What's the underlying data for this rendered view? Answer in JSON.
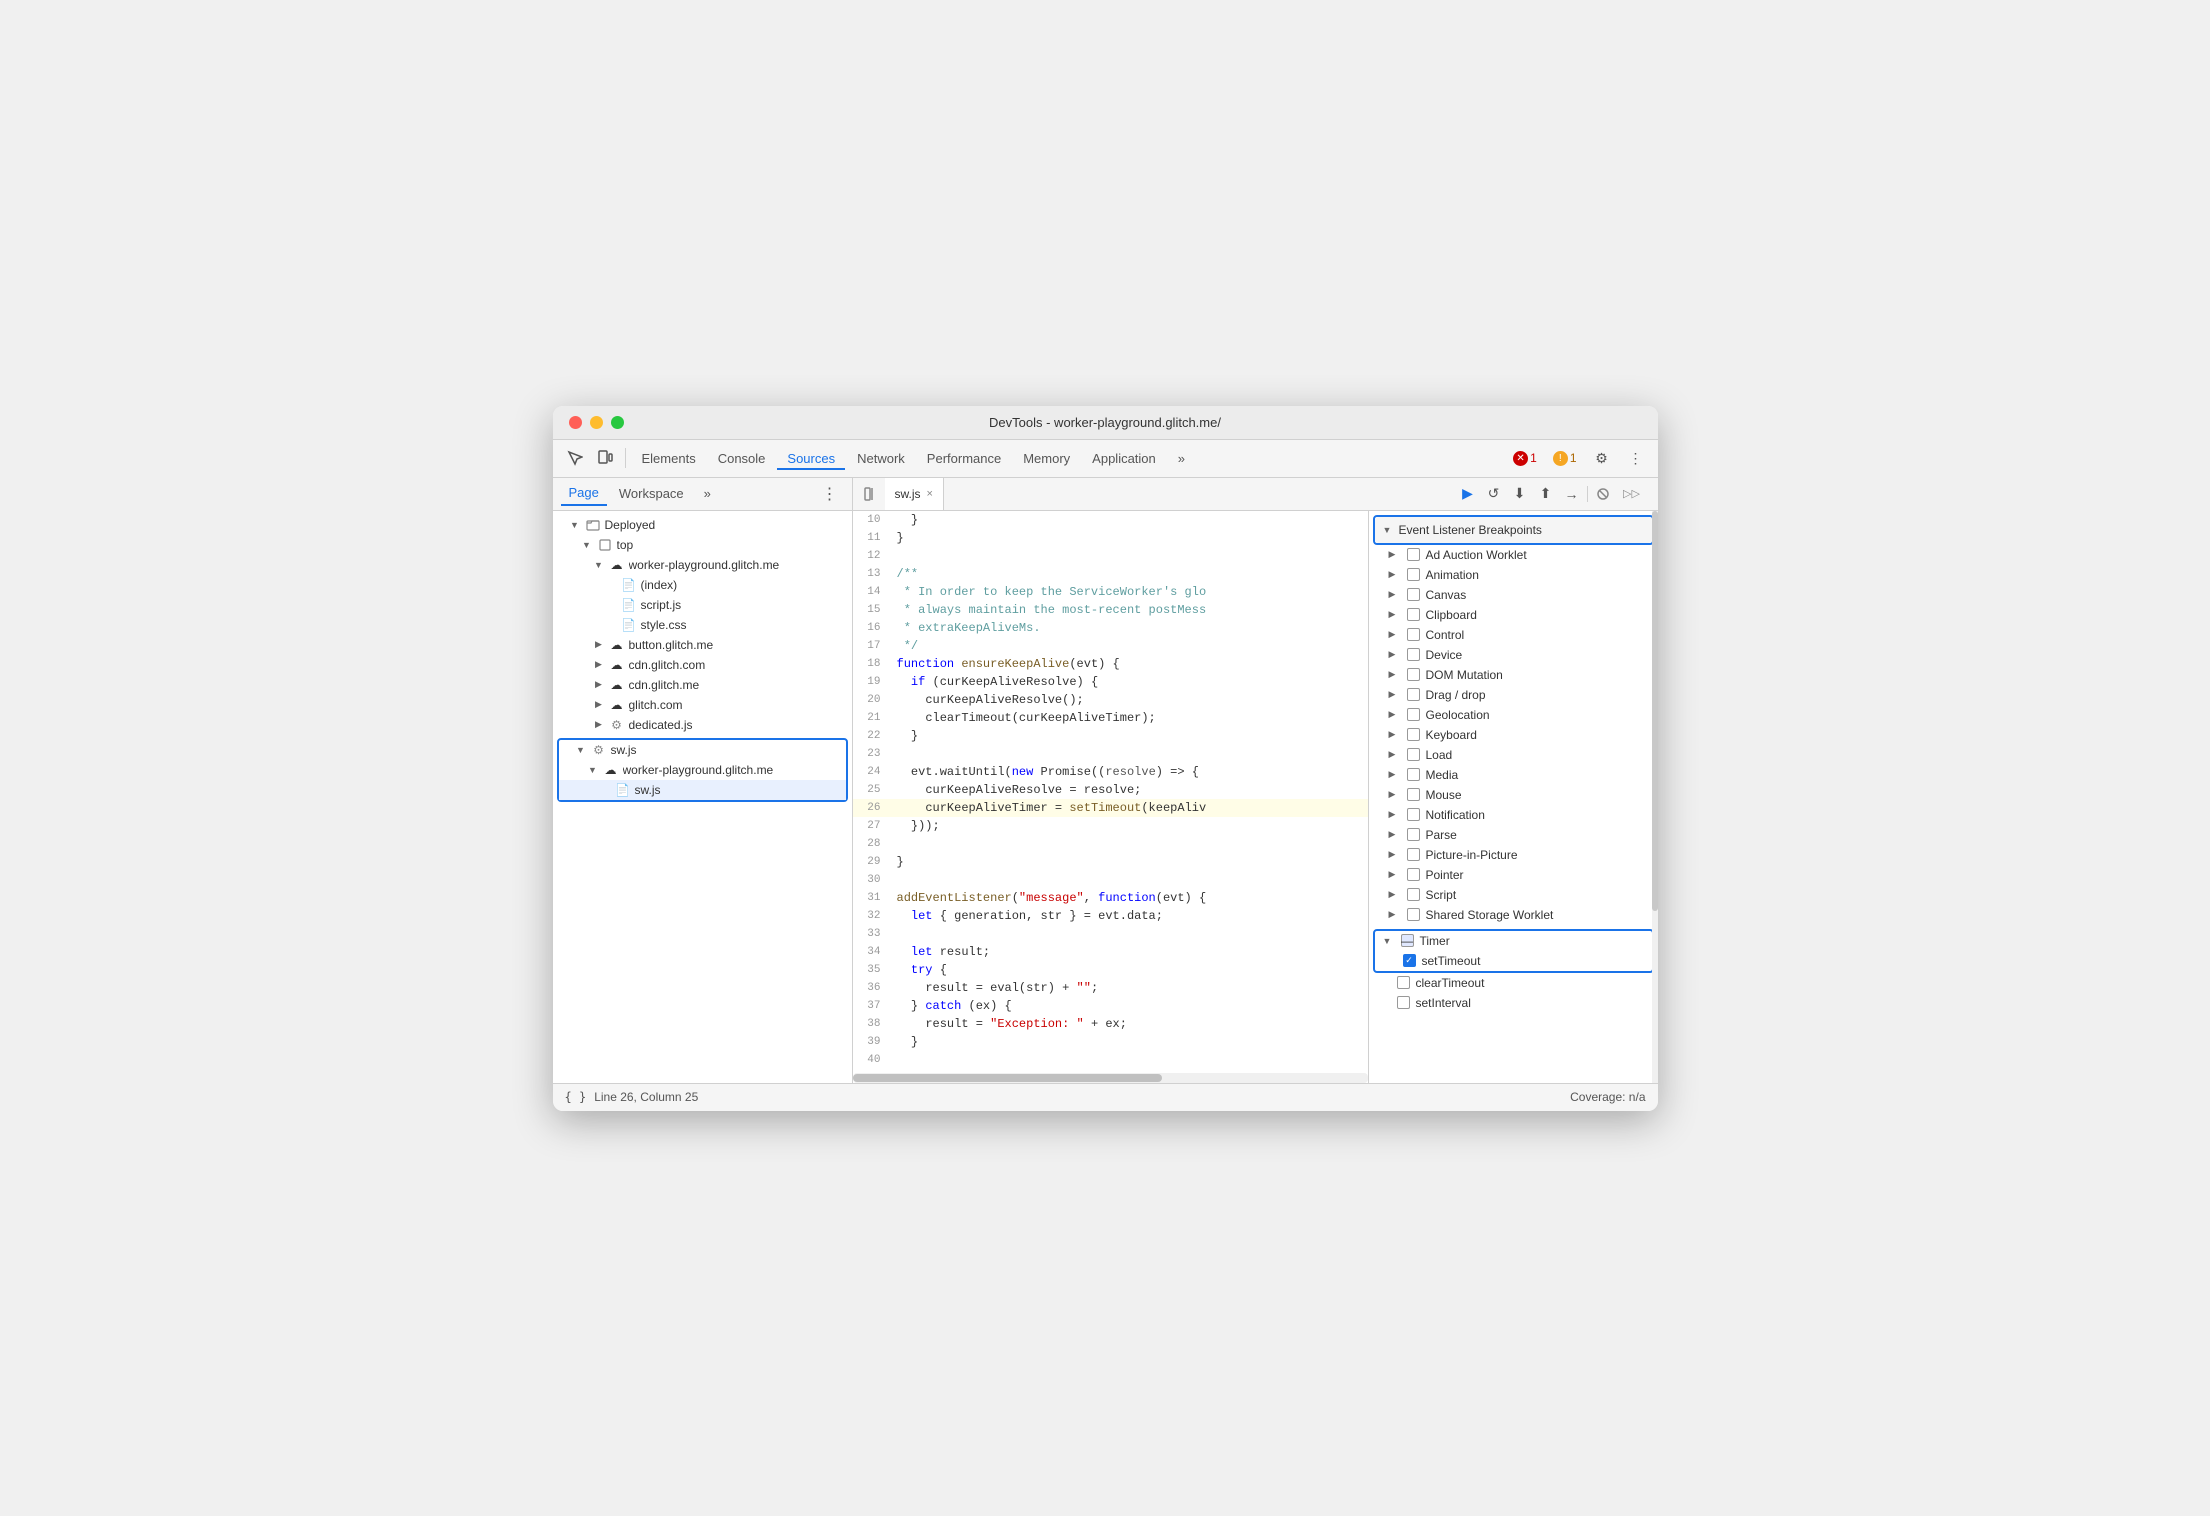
{
  "window": {
    "title": "DevTools - worker-playground.glitch.me/"
  },
  "toolbar": {
    "tabs": [
      {
        "label": "Elements",
        "active": false
      },
      {
        "label": "Console",
        "active": false
      },
      {
        "label": "Sources",
        "active": true
      },
      {
        "label": "Network",
        "active": false
      },
      {
        "label": "Performance",
        "active": false
      },
      {
        "label": "Memory",
        "active": false
      },
      {
        "label": "Application",
        "active": false
      }
    ],
    "more_label": "»",
    "error_count": "1",
    "warning_count": "1"
  },
  "secondary_toolbar": {
    "tabs": [
      {
        "label": "Page",
        "active": true
      },
      {
        "label": "Workspace",
        "active": false
      },
      {
        "label": "»",
        "active": false
      }
    ]
  },
  "file_tab": {
    "name": "sw.js",
    "close_icon": "×"
  },
  "file_tree": {
    "items": [
      {
        "label": "Deployed",
        "indent": 0,
        "type": "folder",
        "open": true
      },
      {
        "label": "top",
        "indent": 1,
        "type": "folder",
        "open": true
      },
      {
        "label": "worker-playground.glitch.me",
        "indent": 2,
        "type": "cloud",
        "open": true
      },
      {
        "label": "(index)",
        "indent": 3,
        "type": "file-white"
      },
      {
        "label": "script.js",
        "indent": 3,
        "type": "file-orange"
      },
      {
        "label": "style.css",
        "indent": 3,
        "type": "file-purple"
      },
      {
        "label": "button.glitch.me",
        "indent": 2,
        "type": "cloud",
        "open": false
      },
      {
        "label": "cdn.glitch.com",
        "indent": 2,
        "type": "cloud",
        "open": false
      },
      {
        "label": "cdn.glitch.me",
        "indent": 2,
        "type": "cloud",
        "open": false
      },
      {
        "label": "glitch.com",
        "indent": 2,
        "type": "cloud",
        "open": false
      },
      {
        "label": "dedicated.js",
        "indent": 2,
        "type": "gear-file",
        "open": false
      },
      {
        "label": "sw.js",
        "indent": 1,
        "type": "gear-file",
        "open": true,
        "selected_group_start": true
      },
      {
        "label": "worker-playground.glitch.me",
        "indent": 2,
        "type": "cloud",
        "open": true
      },
      {
        "label": "sw.js",
        "indent": 3,
        "type": "file-orange",
        "selected": true,
        "selected_group_end": true
      }
    ]
  },
  "code": {
    "lines": [
      {
        "num": 10,
        "content": "  }"
      },
      {
        "num": 11,
        "content": "}"
      },
      {
        "num": 12,
        "content": ""
      },
      {
        "num": 13,
        "content": "/**",
        "type": "comment"
      },
      {
        "num": 14,
        "content": " * In order to keep the ServiceWorker's glo",
        "type": "comment"
      },
      {
        "num": 15,
        "content": " * always maintain the most-recent postMess",
        "type": "comment"
      },
      {
        "num": 16,
        "content": " * extraKeepAliveMs.",
        "type": "comment"
      },
      {
        "num": 17,
        "content": " */",
        "type": "comment"
      },
      {
        "num": 18,
        "content": "function ensureKeepAlive(evt) {",
        "type": "function"
      },
      {
        "num": 19,
        "content": "  if (curKeepAliveResolve) {",
        "type": "code"
      },
      {
        "num": 20,
        "content": "    curKeepAliveResolve();",
        "type": "code"
      },
      {
        "num": 21,
        "content": "    clearTimeout(curKeepAliveTimer);",
        "type": "code"
      },
      {
        "num": 22,
        "content": "  }",
        "type": "code"
      },
      {
        "num": 23,
        "content": "",
        "type": "code"
      },
      {
        "num": 24,
        "content": "  evt.waitUntil(new Promise((resolve) => {",
        "type": "code"
      },
      {
        "num": 25,
        "content": "    curKeepAliveResolve = resolve;",
        "type": "code"
      },
      {
        "num": 26,
        "content": "    curKeepAliveTimer = setTimeout(keepAliv",
        "type": "highlighted"
      },
      {
        "num": 27,
        "content": "  }));",
        "type": "code"
      },
      {
        "num": 28,
        "content": "",
        "type": "code"
      },
      {
        "num": 29,
        "content": "}",
        "type": "code"
      },
      {
        "num": 30,
        "content": "",
        "type": "code"
      },
      {
        "num": 31,
        "content": "addEventListener(\"message\", function(evt) {",
        "type": "code"
      },
      {
        "num": 32,
        "content": "  let { generation, str } = evt.data;",
        "type": "code"
      },
      {
        "num": 33,
        "content": "",
        "type": "code"
      },
      {
        "num": 34,
        "content": "  let result;",
        "type": "code"
      },
      {
        "num": 35,
        "content": "  try {",
        "type": "code"
      },
      {
        "num": 36,
        "content": "    result = eval(str) + \"\";",
        "type": "code"
      },
      {
        "num": 37,
        "content": "  } catch (ex) {",
        "type": "code"
      },
      {
        "num": 38,
        "content": "    result = \"Exception: \" + ex;",
        "type": "code"
      },
      {
        "num": 39,
        "content": "  }",
        "type": "code"
      },
      {
        "num": 40,
        "content": "",
        "type": "code"
      }
    ]
  },
  "breakpoints": {
    "section_title": "Event Listener Breakpoints",
    "items": [
      {
        "label": "Ad Auction Worklet",
        "checked": false,
        "expandable": true
      },
      {
        "label": "Animation",
        "checked": false,
        "expandable": true
      },
      {
        "label": "Canvas",
        "checked": false,
        "expandable": true
      },
      {
        "label": "Clipboard",
        "checked": false,
        "expandable": true
      },
      {
        "label": "Control",
        "checked": false,
        "expandable": true
      },
      {
        "label": "Device",
        "checked": false,
        "expandable": true
      },
      {
        "label": "DOM Mutation",
        "checked": false,
        "expandable": true
      },
      {
        "label": "Drag / drop",
        "checked": false,
        "expandable": true
      },
      {
        "label": "Geolocation",
        "checked": false,
        "expandable": true
      },
      {
        "label": "Keyboard",
        "checked": false,
        "expandable": true
      },
      {
        "label": "Load",
        "checked": false,
        "expandable": true
      },
      {
        "label": "Media",
        "checked": false,
        "expandable": true
      },
      {
        "label": "Mouse",
        "checked": false,
        "expandable": true
      },
      {
        "label": "Notification",
        "checked": false,
        "expandable": true
      },
      {
        "label": "Parse",
        "checked": false,
        "expandable": true
      },
      {
        "label": "Picture-in-Picture",
        "checked": false,
        "expandable": true
      },
      {
        "label": "Pointer",
        "checked": false,
        "expandable": true
      },
      {
        "label": "Script",
        "checked": false,
        "expandable": true
      },
      {
        "label": "Shared Storage Worklet",
        "checked": false,
        "expandable": true
      }
    ],
    "timer_section": {
      "label": "Timer",
      "expanded": true,
      "items": [
        {
          "label": "setTimeout",
          "checked": true,
          "highlighted": true
        },
        {
          "label": "clearTimeout",
          "checked": false
        },
        {
          "label": "setInterval",
          "checked": false
        }
      ]
    }
  },
  "status_bar": {
    "format_icon": "{ }",
    "position": "Line 26, Column 25",
    "coverage": "Coverage: n/a"
  },
  "debug_toolbar": {
    "icons": [
      "▶",
      "↺",
      "⬇",
      "⬆",
      "→|"
    ]
  }
}
